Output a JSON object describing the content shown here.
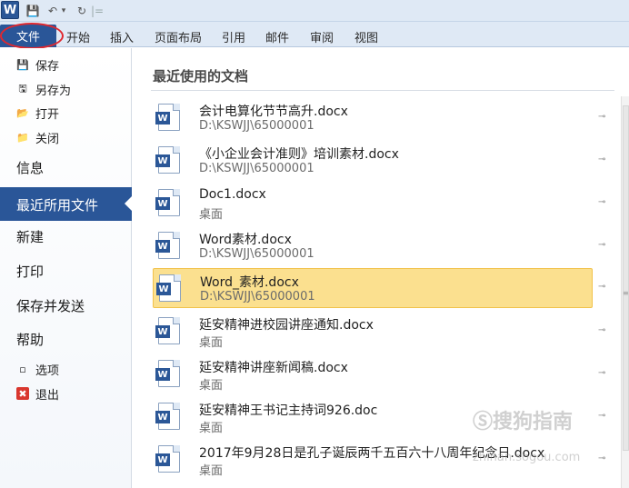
{
  "qat": {
    "logo": "W",
    "save_icon": "💾",
    "undo_icon": "↶",
    "undo_drop": "▾",
    "redo_icon": "↻",
    "sep": "|="
  },
  "tabs": [
    "文件",
    "开始",
    "插入",
    "页面布局",
    "引用",
    "邮件",
    "审阅",
    "视图"
  ],
  "sidebar": {
    "small_top": [
      {
        "label": "保存",
        "icon": "💾"
      },
      {
        "label": "另存为",
        "icon": "🖫"
      },
      {
        "label": "打开",
        "icon": "📂"
      },
      {
        "label": "关闭",
        "icon": "📁"
      }
    ],
    "info": "信息",
    "recent": "最近所用文件",
    "new": "新建",
    "print": "打印",
    "save_send": "保存并发送",
    "help": "帮助",
    "small_bottom": [
      {
        "label": "选项",
        "icon": "▫"
      },
      {
        "label": "退出",
        "icon": "✖"
      }
    ]
  },
  "main": {
    "title": "最近使用的文档",
    "pin_icon": "⊸",
    "documents": [
      {
        "name": "会计电算化节节高升.docx",
        "path": "D:\\KSWJJ\\65000001"
      },
      {
        "name": "《小企业会计准则》培训素材.docx",
        "path": "D:\\KSWJJ\\65000001"
      },
      {
        "name": "Doc1.docx",
        "path": "桌面"
      },
      {
        "name": "Word素材.docx",
        "path": "D:\\KSWJJ\\65000001"
      },
      {
        "name": "Word_素材.docx",
        "path": "D:\\KSWJJ\\65000001"
      },
      {
        "name": "延安精神进校园讲座通知.docx",
        "path": "桌面"
      },
      {
        "name": "延安精神讲座新闻稿.docx",
        "path": "桌面"
      },
      {
        "name": "延安精神王书记主持词926.doc",
        "path": "桌面"
      },
      {
        "name": "2017年9月28日是孔子诞辰两千五百六十八周年纪念日.docx",
        "path": "桌面"
      }
    ]
  },
  "watermark": {
    "text": "Ⓢ搜狗指南",
    "sub": "zhinan.sogou.com"
  },
  "colors": {
    "accent": "#2a5698",
    "selected_row": "#fbe08f",
    "highlight_circle": "#e0282f"
  }
}
